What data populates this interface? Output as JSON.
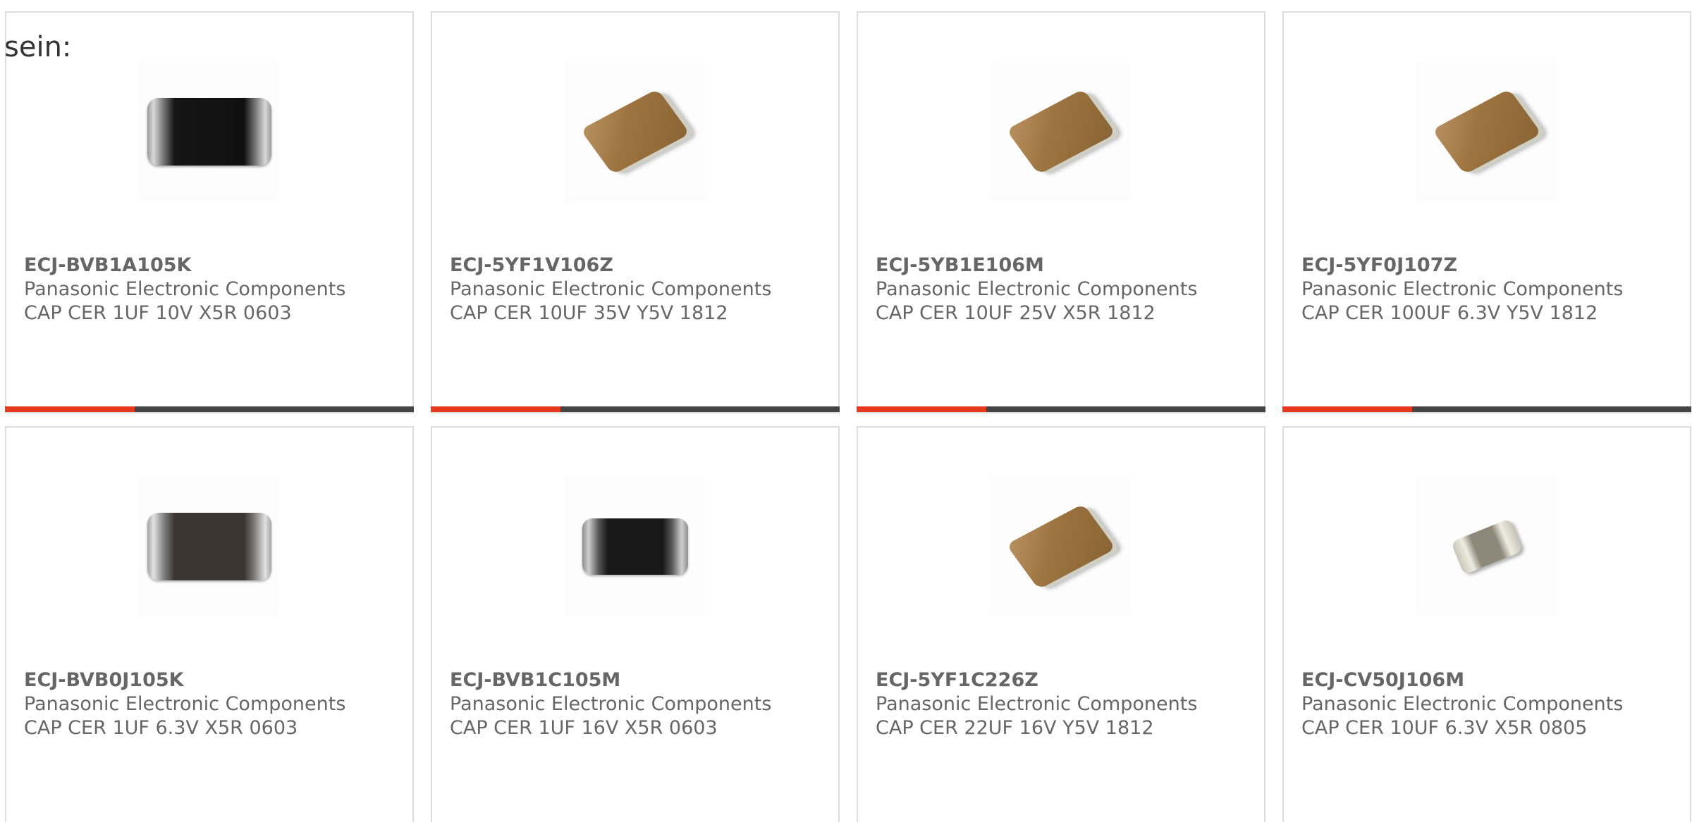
{
  "intro": {
    "text": "sein:"
  },
  "colors": {
    "accent": "#e63a1c",
    "bar": "#444444",
    "border": "#dddddd",
    "text": "#666666"
  },
  "products": [
    {
      "part_number": "ECJ-BVB1A105K",
      "manufacturer": "Panasonic Electronic Components",
      "description": "CAP CER 1UF 10V X5R 0603",
      "image_icon": "chip-black"
    },
    {
      "part_number": "ECJ-5YF1V106Z",
      "manufacturer": "Panasonic Electronic Components",
      "description": "CAP CER 10UF 35V Y5V 1812",
      "image_icon": "chip-brown"
    },
    {
      "part_number": "ECJ-5YB1E106M",
      "manufacturer": "Panasonic Electronic Components",
      "description": "CAP CER 10UF 25V X5R 1812",
      "image_icon": "chip-brown"
    },
    {
      "part_number": "ECJ-5YF0J107Z",
      "manufacturer": "Panasonic Electronic Components",
      "description": "CAP CER 100UF 6.3V Y5V 1812",
      "image_icon": "chip-brown"
    },
    {
      "part_number": "ECJ-BVB0J105K",
      "manufacturer": "Panasonic Electronic Components",
      "description": "CAP CER 1UF 6.3V X5R 0603",
      "image_icon": "chip-darkgray"
    },
    {
      "part_number": "ECJ-BVB1C105M",
      "manufacturer": "Panasonic Electronic Components",
      "description": "CAP CER 1UF 16V X5R 0603",
      "image_icon": "chip-small-black"
    },
    {
      "part_number": "ECJ-5YF1C226Z",
      "manufacturer": "Panasonic Electronic Components",
      "description": "CAP CER 22UF 16V Y5V 1812",
      "image_icon": "chip-brown"
    },
    {
      "part_number": "ECJ-CV50J106M",
      "manufacturer": "Panasonic Electronic Components",
      "description": "CAP CER 10UF 6.3V X5R 0805",
      "image_icon": "chip-small-gray"
    }
  ]
}
